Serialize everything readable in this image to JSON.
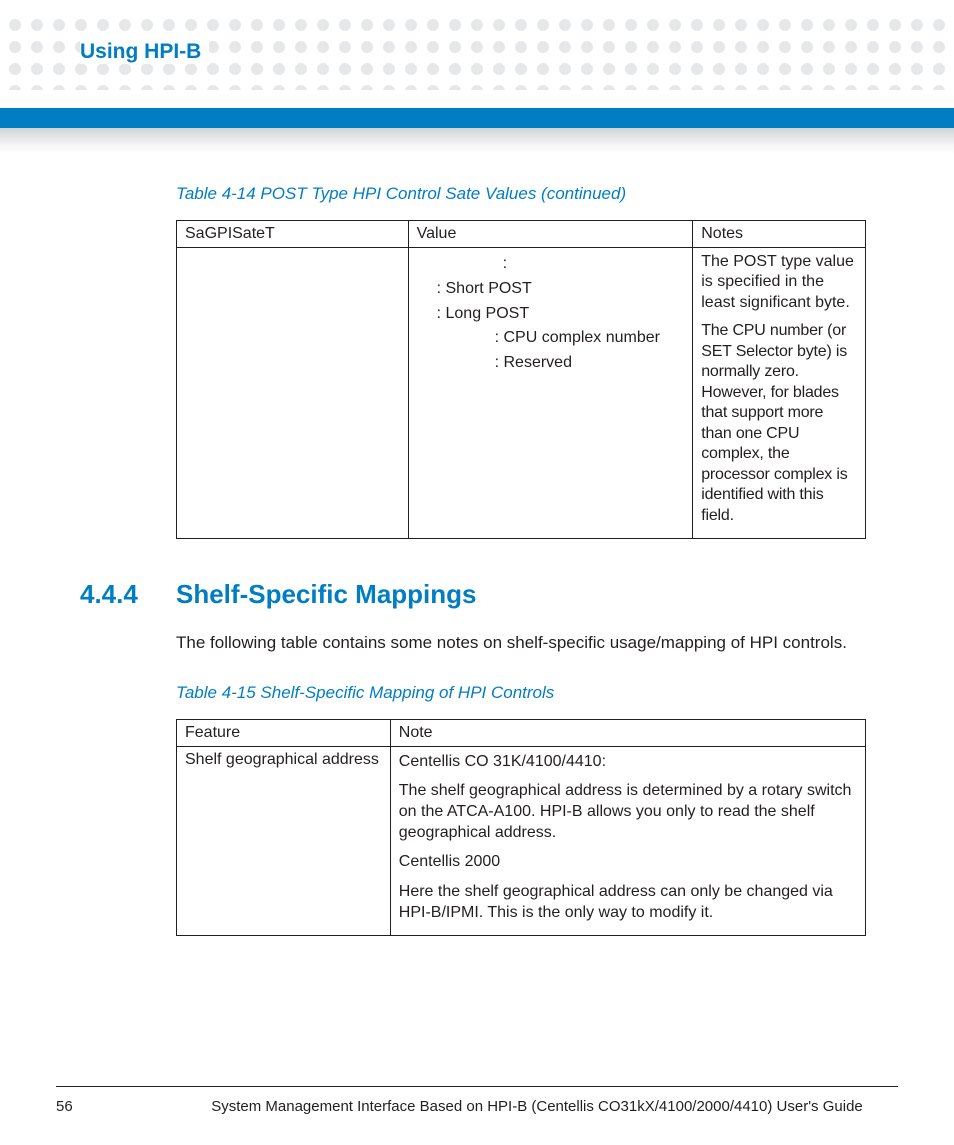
{
  "header": {
    "chapter": "Using HPI-B"
  },
  "table414": {
    "caption": "Table 4-14 POST Type HPI Control Sate Values (continued)",
    "headers": {
      "c1": "SaGPISateT",
      "c2": "Value",
      "c3": "Notes"
    },
    "value_lines": {
      "l1": ":",
      "l2": ": Short POST",
      "l3": ": Long POST",
      "l4": ": CPU complex number",
      "l5": ": Reserved"
    },
    "notes": {
      "p1": "The POST type value is specified in the least significant byte.",
      "p2": "The CPU number (or SET Selector byte) is normally zero. However, for blades that support more than one CPU complex, the processor complex is identified with this field."
    }
  },
  "section": {
    "number": "4.4.4",
    "title": "Shelf-Specific Mappings",
    "intro": "The following table contains some notes on shelf-specific usage/mapping of HPI controls."
  },
  "table415": {
    "caption": "Table 4-15 Shelf-Specific Mapping of HPI Controls",
    "headers": {
      "c1": "Feature",
      "c2": "Note"
    },
    "row": {
      "feature": "Shelf geographical address",
      "p1": "Centellis CO 31K/4100/4410:",
      "p2": "The shelf geographical address is determined by a rotary switch on the ATCA-A100. HPI-B allows you only to read the shelf geographical address.",
      "p3": "Centellis 2000",
      "p4": "Here the shelf geographical address can only be changed via HPI-B/IPMI. This is the only way to modify it."
    }
  },
  "footer": {
    "page": "56",
    "guide": "System Management Interface Based on HPI-B (Centellis CO31kX/4100/2000/4410) User's Guide"
  }
}
